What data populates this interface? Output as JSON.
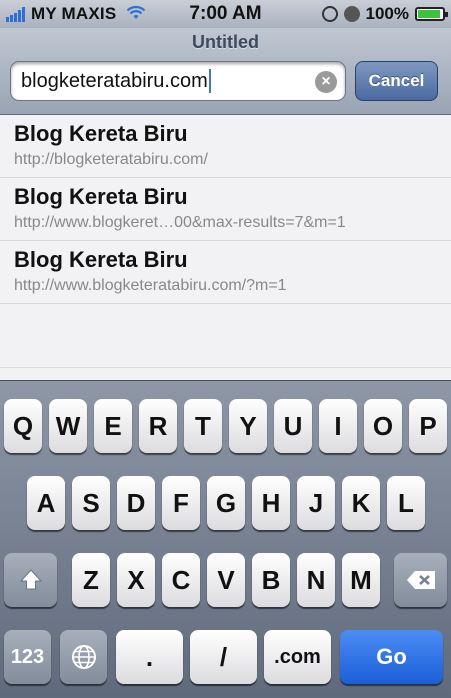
{
  "status_bar": {
    "carrier": "MY MAXIS",
    "time": "7:00 AM",
    "battery": "100%"
  },
  "toolbar": {
    "title": "Untitled",
    "url_value": "blogketeratabiru.com",
    "cancel_label": "Cancel"
  },
  "suggestions": [
    {
      "title": "Blog Kereta Biru",
      "url": "http://blogketeratabiru.com/"
    },
    {
      "title": "Blog Kereta Biru",
      "url": "http://www.blogkeret…00&max-results=7&m=1"
    },
    {
      "title": "Blog Kereta Biru",
      "url": "http://www.blogketeratabiru.com/?m=1"
    }
  ],
  "keyboard": {
    "row1": [
      "Q",
      "W",
      "E",
      "R",
      "T",
      "Y",
      "U",
      "I",
      "O",
      "P"
    ],
    "row2": [
      "A",
      "S",
      "D",
      "F",
      "G",
      "H",
      "J",
      "K",
      "L"
    ],
    "row3": [
      "Z",
      "X",
      "C",
      "V",
      "B",
      "N",
      "M"
    ],
    "numbers_label": "123",
    "dot_label": ".",
    "slash_label": "/",
    "dotcom_label": ".com",
    "go_label": "Go",
    "shift_icon": "shift-icon",
    "delete_icon": "backspace-icon",
    "globe_icon": "globe-icon"
  }
}
